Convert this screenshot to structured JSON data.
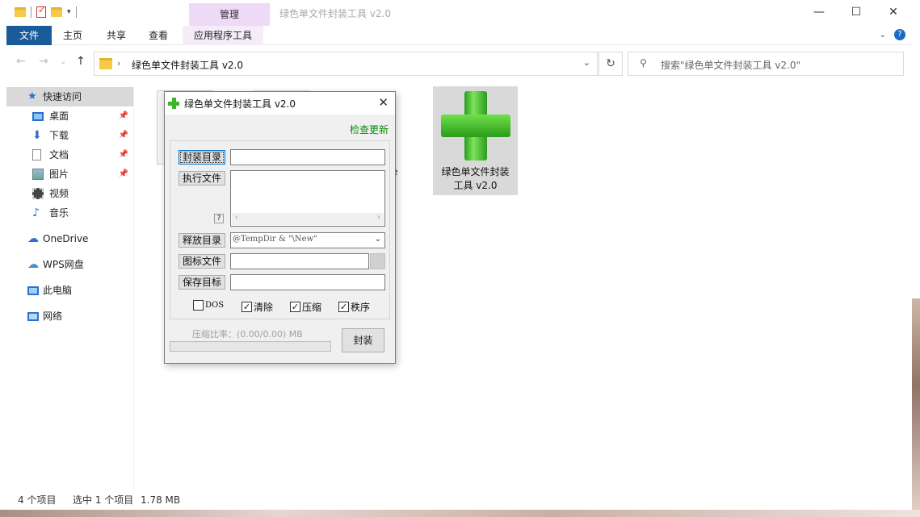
{
  "window": {
    "title": "绿色单文件封装工具 v2.0"
  },
  "ribbon": {
    "context_group": "管理",
    "tabs": [
      {
        "label": "文件"
      },
      {
        "label": "主页"
      },
      {
        "label": "共享"
      },
      {
        "label": "查看"
      },
      {
        "label": "应用程序工具"
      }
    ]
  },
  "address": {
    "path": "绿色单文件封装工具 v2.0"
  },
  "search": {
    "placeholder": "搜索\"绿色单文件封装工具 v2.0\""
  },
  "sidebar": {
    "items": [
      {
        "label": "快速访问",
        "icon": "star-icon"
      },
      {
        "label": "桌面",
        "icon": "desktop-icon",
        "pinned": true
      },
      {
        "label": "下载",
        "icon": "download-icon",
        "pinned": true
      },
      {
        "label": "文档",
        "icon": "document-icon",
        "pinned": true
      },
      {
        "label": "图片",
        "icon": "picture-icon",
        "pinned": true
      },
      {
        "label": "视频",
        "icon": "video-icon"
      },
      {
        "label": "音乐",
        "icon": "music-icon"
      },
      {
        "label": "OneDrive",
        "icon": "cloud-icon"
      },
      {
        "label": "WPS网盘",
        "icon": "cloud-drive-icon"
      },
      {
        "label": "此电脑",
        "icon": "computer-icon"
      },
      {
        "label": "网络",
        "icon": "network-icon"
      }
    ]
  },
  "files": {
    "peek_char": "e",
    "selected": {
      "name_line1": "绿色单文件封装",
      "name_line2": "工具 v2.0"
    }
  },
  "status": {
    "count": "4 个项目",
    "selection": "选中 1 个项目",
    "size": "1.78 MB"
  },
  "dialog": {
    "title": "绿色单文件封装工具 v2.0",
    "check_update": "检查更新",
    "buttons": {
      "pack_dir": "封装目录",
      "exec_file": "执行文件",
      "help": "?",
      "release_dir": "释放目录",
      "icon_file": "图标文件",
      "save_target": "保存目标",
      "pack": "封装"
    },
    "release_dir_value": "@TempDir & \"\\New\"",
    "options": [
      {
        "label": "DOS",
        "checked": false
      },
      {
        "label": "清除",
        "checked": true
      },
      {
        "label": "压缩",
        "checked": true
      },
      {
        "label": "秩序",
        "checked": true
      }
    ],
    "ratio_text": "压缩比率：(0.00/0.00) MB",
    "progress": 0
  },
  "colors": {
    "file_tab": "#1a5b9c",
    "context_tab": "#eed9f7",
    "update_link": "#0a8a0a"
  }
}
